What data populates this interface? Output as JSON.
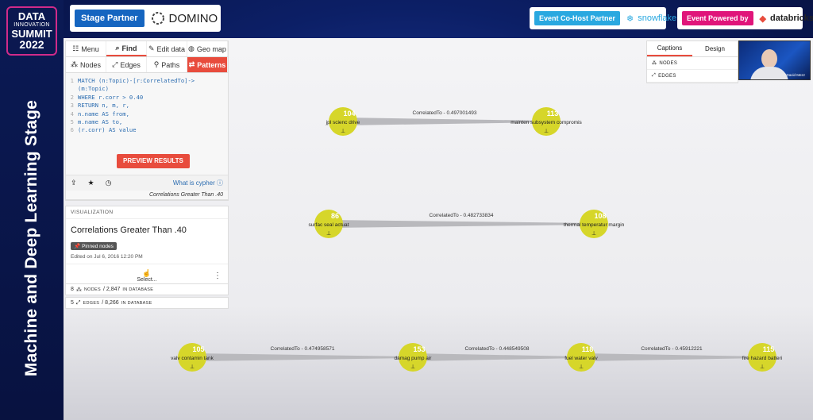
{
  "banner": {
    "logo_line1": "DATA",
    "logo_line2": "INNOVATION",
    "logo_line3": "SUMMIT",
    "logo_line4": "2022",
    "side_title": "Machine and Deep Learning Stage"
  },
  "sponsors": {
    "stage_partner_label": "Stage Partner",
    "stage_partner_brand": "DOMINO",
    "cohost_label": "Event Co-Host Partner",
    "cohost_brand": "snowflake",
    "powered_label": "Event Powered by",
    "powered_brand": "databricks",
    "colors": {
      "stage": "#1565c0",
      "cohost": "#29a8e0",
      "powered": "#e0157a"
    }
  },
  "toolbar": {
    "tabs": [
      {
        "label": "Menu",
        "icon": "menu-icon"
      },
      {
        "label": "Find",
        "icon": "search-icon"
      },
      {
        "label": "Edit data",
        "icon": "edit-icon"
      },
      {
        "label": "Geo map",
        "icon": "globe-icon"
      }
    ],
    "subtabs": [
      {
        "label": "Nodes",
        "icon": "nodes-icon"
      },
      {
        "label": "Edges",
        "icon": "edges-icon"
      },
      {
        "label": "Paths",
        "icon": "paths-icon"
      },
      {
        "label": "Patterns",
        "icon": "patterns-icon"
      }
    ]
  },
  "query": {
    "lines": [
      [
        "1",
        "MATCH (n:Topic)-[r:CorrelatedTo]->"
      ],
      [
        "",
        "(m:Topic)"
      ],
      [
        "2",
        "WHERE r.corr > 0.40"
      ],
      [
        "3",
        "RETURN n, m, r,"
      ],
      [
        "4",
        "n.name AS from,"
      ],
      [
        "5",
        "m.name AS to,"
      ],
      [
        "6",
        "(r.corr) AS value"
      ]
    ],
    "preview_label": "PREVIEW RESULTS",
    "what_is_cypher": "What is cypher",
    "caption": "Correlations Greater Than .40"
  },
  "visualization": {
    "header": "VISUALIZATION",
    "title": "Correlations Greater Than .40",
    "pinned_label": "Pinned nodes",
    "edited": "Edited on Jul 6, 2016 12:20 PM",
    "select_label": "Select..."
  },
  "counts": {
    "nodes_shown": "8",
    "nodes_word": "NODES",
    "nodes_total": "/ 2,847",
    "nodes_suffix": "IN DATABASE",
    "edges_shown": "5",
    "edges_word": "EDGES",
    "edges_total": "/ 8,266",
    "edges_suffix": "IN DATABASE"
  },
  "captions_panel": {
    "tabs": [
      "Captions",
      "Design"
    ],
    "items": [
      "NODES",
      "EDGES"
    ],
    "presenter_name": "David Mezz"
  },
  "graph": {
    "node_color": "#d6d62a",
    "edge_color": "#b9b9bd",
    "nodes": [
      {
        "id": "n104",
        "num": "104",
        "label": "jpl scienc drive"
      },
      {
        "id": "n113",
        "num": "113",
        "label": "mainten subsystem compromis"
      },
      {
        "id": "n86",
        "num": "86",
        "label": "surfac seal actuat"
      },
      {
        "id": "n108",
        "num": "108",
        "label": "thermal temperatur margin"
      },
      {
        "id": "n105",
        "num": "105",
        "label": "valv contamin tank"
      },
      {
        "id": "n153",
        "num": "153",
        "label": "damag pump air"
      },
      {
        "id": "n118",
        "num": "118",
        "label": "fuel water valv"
      },
      {
        "id": "n115",
        "num": "115",
        "label": "fire hazard batteri"
      }
    ],
    "edges": [
      {
        "from": "n104",
        "to": "n113",
        "label": "CorrelatedTo - 0.497001493"
      },
      {
        "from": "n86",
        "to": "n108",
        "label": "CorrelatedTo - 0.482733834"
      },
      {
        "from": "n105",
        "to": "n153",
        "label": "CorrelatedTo - 0.474958571"
      },
      {
        "from": "n153",
        "to": "n118",
        "label": "CorrelatedTo - 0.448549508"
      },
      {
        "from": "n118",
        "to": "n115",
        "label": "CorrelatedTo - 0.45912221"
      }
    ]
  }
}
